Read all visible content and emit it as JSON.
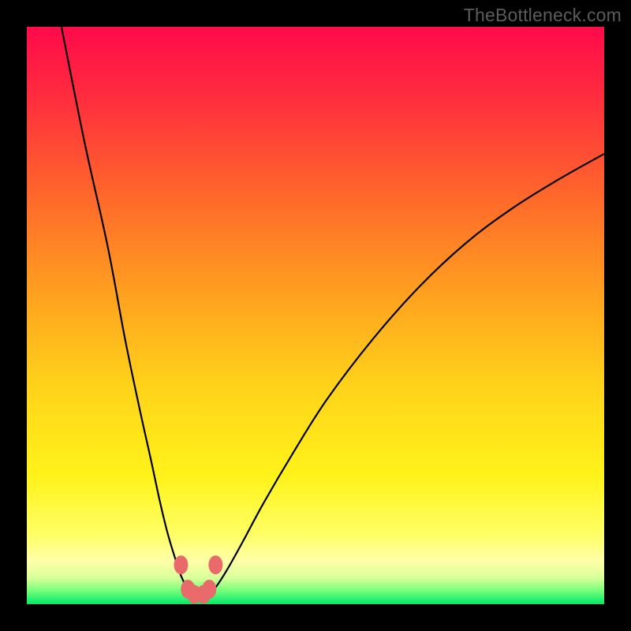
{
  "watermark": "TheBottleneck.com",
  "chart_data": {
    "type": "line",
    "title": "",
    "xlabel": "",
    "ylabel": "",
    "xlim": [
      0,
      100
    ],
    "ylim": [
      0,
      100
    ],
    "background_gradient": {
      "stops": [
        {
          "offset": 0.0,
          "color": "#ff0a4a"
        },
        {
          "offset": 0.12,
          "color": "#ff2c3e"
        },
        {
          "offset": 0.3,
          "color": "#ff6a2a"
        },
        {
          "offset": 0.48,
          "color": "#ffa61e"
        },
        {
          "offset": 0.62,
          "color": "#ffd21a"
        },
        {
          "offset": 0.78,
          "color": "#fff31a"
        },
        {
          "offset": 0.88,
          "color": "#ffff66"
        },
        {
          "offset": 0.925,
          "color": "#ffffa8"
        },
        {
          "offset": 0.955,
          "color": "#d8ff9a"
        },
        {
          "offset": 0.975,
          "color": "#7dff7d"
        },
        {
          "offset": 1.0,
          "color": "#00e96a"
        }
      ]
    },
    "series": [
      {
        "name": "left-branch",
        "x": [
          6.0,
          10.0,
          14.0,
          17.0,
          19.5,
          21.5,
          23.0,
          24.2,
          25.2,
          26.0,
          26.6,
          27.2,
          27.6,
          28.0
        ],
        "y": [
          100.0,
          80.0,
          62.0,
          46.0,
          34.0,
          25.0,
          18.0,
          13.0,
          9.5,
          7.0,
          5.2,
          3.8,
          2.8,
          2.0
        ]
      },
      {
        "name": "right-branch",
        "x": [
          32.0,
          33.2,
          35.0,
          37.5,
          41.0,
          46.0,
          52.0,
          60.0,
          68.0,
          76.0,
          84.0,
          92.0,
          100.0
        ],
        "y": [
          2.0,
          3.6,
          6.5,
          11.0,
          17.5,
          26.0,
          35.5,
          46.0,
          55.0,
          62.5,
          68.5,
          73.5,
          78.0
        ]
      },
      {
        "name": "valley-floor",
        "x": [
          28.0,
          29.0,
          30.0,
          31.0,
          32.0
        ],
        "y": [
          2.0,
          1.6,
          1.5,
          1.6,
          2.0
        ]
      }
    ],
    "markers": [
      {
        "name": "p1",
        "x": 26.7,
        "y": 6.8
      },
      {
        "name": "p2",
        "x": 32.7,
        "y": 6.8
      },
      {
        "name": "p3",
        "x": 27.9,
        "y": 2.6
      },
      {
        "name": "p4",
        "x": 31.6,
        "y": 2.6
      },
      {
        "name": "p5",
        "x": 29.0,
        "y": 1.7
      },
      {
        "name": "p6",
        "x": 30.6,
        "y": 1.7
      }
    ],
    "colors": {
      "curve": "#000000",
      "marker_fill": "#e96a6a",
      "marker_stroke": "#c44d4d"
    }
  }
}
